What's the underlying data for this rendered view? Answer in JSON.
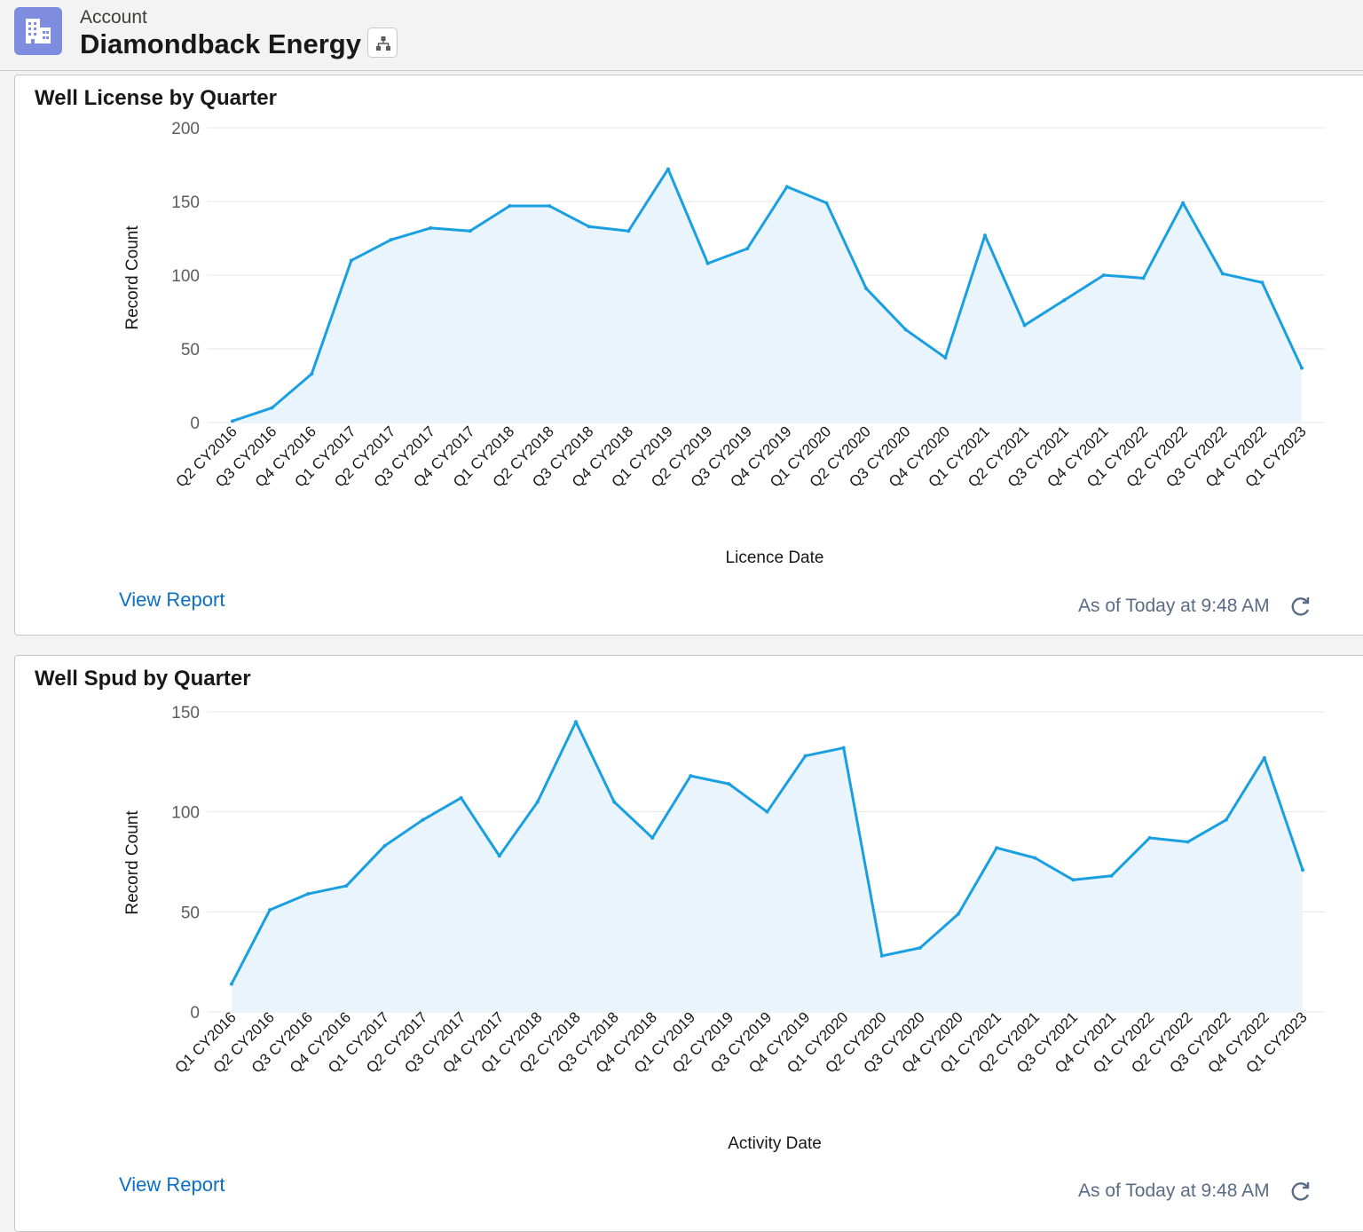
{
  "header": {
    "object_label": "Account",
    "record_name": "Diamondback Energy",
    "icon": "building-icon",
    "hierarchy_icon": "hierarchy-icon"
  },
  "cards": [
    {
      "title": "Well License by Quarter",
      "view_report": "View Report",
      "as_of": "As of Today at 9:48 AM",
      "refresh_icon": "refresh-icon"
    },
    {
      "title": "Well Spud by Quarter",
      "view_report": "View Report",
      "as_of": "As of Today at 9:48 AM",
      "refresh_icon": "refresh-icon"
    }
  ],
  "colors": {
    "line": "#1a9fe0",
    "fill": "#e9f4fc",
    "grid": "#e5e5e5",
    "link": "#0b6fc4"
  },
  "chart_data": [
    {
      "type": "area",
      "title": "Well License by Quarter",
      "xlabel": "Licence Date",
      "ylabel": "Record Count",
      "ylim": [
        0,
        200
      ],
      "yticks": [
        0,
        50,
        100,
        150,
        200
      ],
      "categories": [
        "Q2 CY2016",
        "Q3 CY2016",
        "Q4 CY2016",
        "Q1 CY2017",
        "Q2 CY2017",
        "Q3 CY2017",
        "Q4 CY2017",
        "Q1 CY2018",
        "Q2 CY2018",
        "Q3 CY2018",
        "Q4 CY2018",
        "Q1 CY2019",
        "Q2 CY2019",
        "Q3 CY2019",
        "Q4 CY2019",
        "Q1 CY2020",
        "Q2 CY2020",
        "Q3 CY2020",
        "Q4 CY2020",
        "Q1 CY2021",
        "Q2 CY2021",
        "Q3 CY2021",
        "Q4 CY2021",
        "Q1 CY2022",
        "Q2 CY2022",
        "Q3 CY2022",
        "Q4 CY2022",
        "Q1 CY2023"
      ],
      "values": [
        1,
        10,
        33,
        110,
        124,
        132,
        130,
        147,
        147,
        133,
        130,
        172,
        108,
        118,
        160,
        149,
        91,
        63,
        44,
        127,
        66,
        83,
        100,
        98,
        149,
        101,
        95,
        37
      ],
      "grid": true
    },
    {
      "type": "area",
      "title": "Well Spud by Quarter",
      "xlabel": "Activity Date",
      "ylabel": "Record Count",
      "ylim": [
        0,
        150
      ],
      "yticks": [
        0,
        50,
        100,
        150
      ],
      "categories": [
        "Q1 CY2016",
        "Q2 CY2016",
        "Q3 CY2016",
        "Q4 CY2016",
        "Q1 CY2017",
        "Q2 CY2017",
        "Q3 CY2017",
        "Q4 CY2017",
        "Q1 CY2018",
        "Q2 CY2018",
        "Q3 CY2018",
        "Q4 CY2018",
        "Q1 CY2019",
        "Q2 CY2019",
        "Q3 CY2019",
        "Q4 CY2019",
        "Q1 CY2020",
        "Q2 CY2020",
        "Q3 CY2020",
        "Q4 CY2020",
        "Q1 CY2021",
        "Q2 CY2021",
        "Q3 CY2021",
        "Q4 CY2021",
        "Q1 CY2022",
        "Q2 CY2022",
        "Q3 CY2022",
        "Q4 CY2022",
        "Q1 CY2023"
      ],
      "values": [
        14,
        51,
        59,
        63,
        83,
        96,
        107,
        78,
        105,
        145,
        105,
        87,
        118,
        114,
        100,
        128,
        132,
        28,
        32,
        49,
        82,
        77,
        66,
        68,
        87,
        85,
        96,
        127,
        71
      ],
      "grid": true
    }
  ]
}
